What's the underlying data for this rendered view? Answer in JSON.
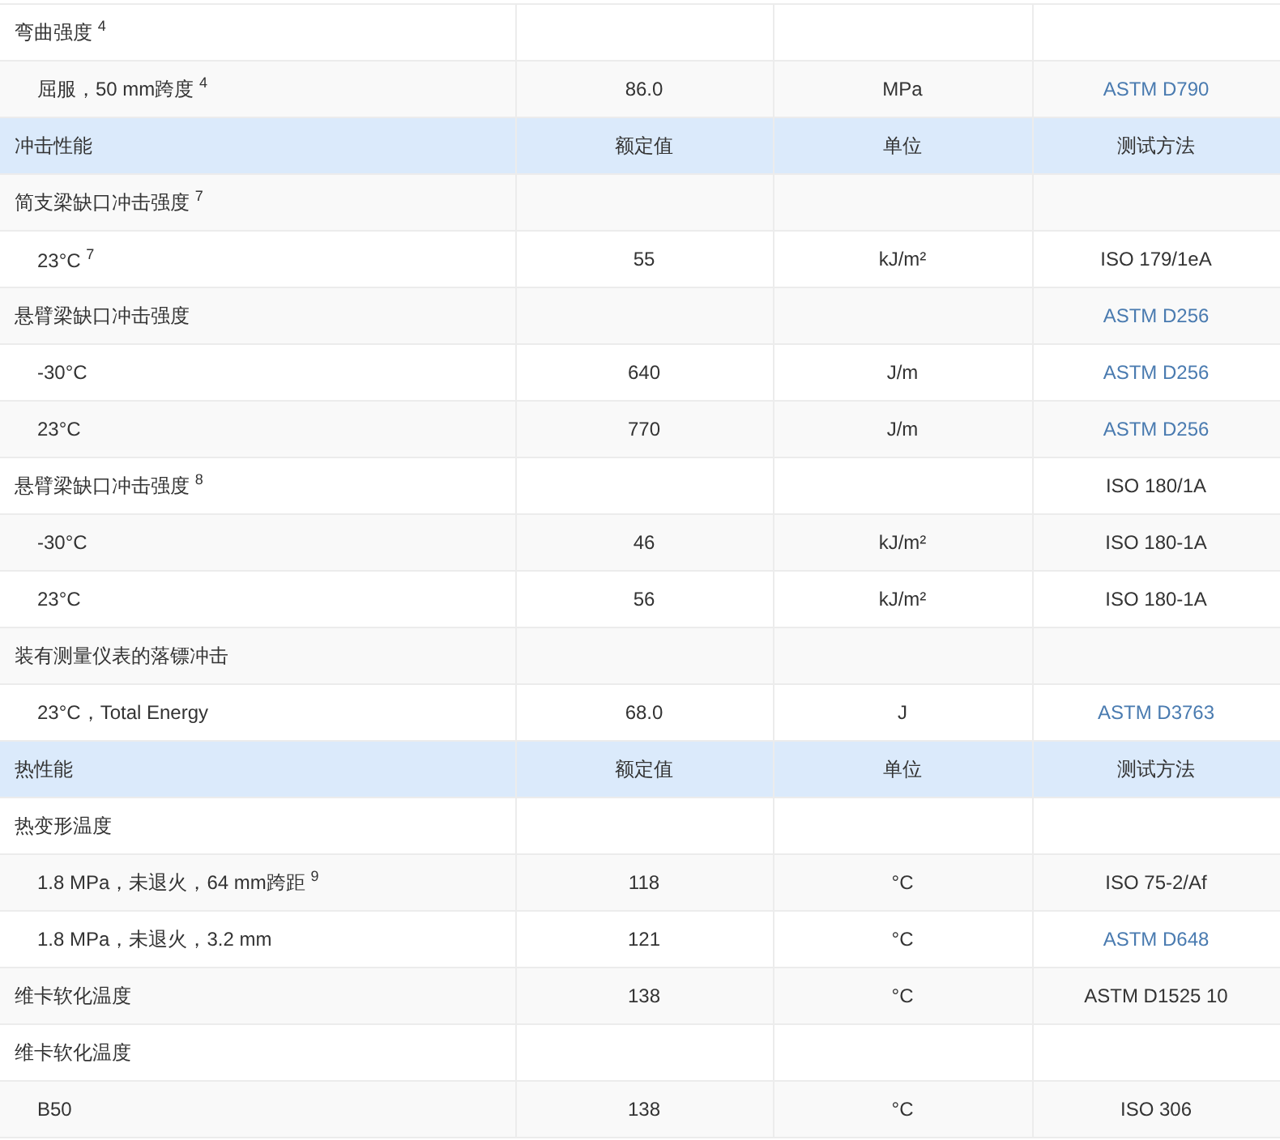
{
  "sections": [
    {
      "rows": [
        {
          "property": "弯曲强度 $^{4}$",
          "children": [
            {
              "property": "屈服，50 mm跨度 $^{4}$",
              "value": "86.0",
              "unit": "MPa",
              "method": "ASTM D790",
              "method_link": true
            }
          ]
        }
      ]
    },
    {
      "header": {
        "title": "冲击性能",
        "value": "额定值",
        "unit": "单位",
        "method": "测试方法"
      },
      "rows": [
        {
          "property": "简支梁缺口冲击强度 $^{7}$",
          "children": [
            {
              "property": "23°C $^{7}$",
              "value": "55",
              "unit": "kJ/m²",
              "method": "ISO 179/1eA",
              "method_link": false
            }
          ]
        },
        {
          "property": "悬臂梁缺口冲击强度",
          "method": "ASTM D256",
          "method_link": true,
          "children": [
            {
              "property": "-30°C",
              "value": "640",
              "unit": "J/m",
              "method": "ASTM D256",
              "method_link": true
            },
            {
              "property": "23°C",
              "value": "770",
              "unit": "J/m",
              "method": "ASTM D256",
              "method_link": true
            }
          ]
        },
        {
          "property": "悬臂梁缺口冲击强度 $^{8}$",
          "method": "ISO 180/1A",
          "method_link": false,
          "children": [
            {
              "property": "-30°C",
              "value": "46",
              "unit": "kJ/m²",
              "method": "ISO 180-1A",
              "method_link": false
            },
            {
              "property": "23°C",
              "value": "56",
              "unit": "kJ/m²",
              "method": "ISO 180-1A",
              "method_link": false
            }
          ]
        },
        {
          "property": "装有测量仪表的落镖冲击",
          "children": [
            {
              "property": "23°C，Total Energy",
              "value": "68.0",
              "unit": "J",
              "method": "ASTM D3763",
              "method_link": true
            }
          ]
        }
      ]
    },
    {
      "header": {
        "title": "热性能",
        "value": "额定值",
        "unit": "单位",
        "method": "测试方法"
      },
      "rows": [
        {
          "property": "热变形温度",
          "children": [
            {
              "property": "1.8 MPa，未退火，64 mm跨距 $^{9}$",
              "value": "118",
              "unit": "°C",
              "method": "ISO 75-2/Af",
              "method_link": false
            },
            {
              "property": "1.8 MPa，未退火，3.2 mm",
              "value": "121",
              "unit": "°C",
              "method": "ASTM D648",
              "method_link": true
            }
          ]
        },
        {
          "property": "维卡软化温度",
          "value": "138",
          "unit": "°C",
          "method": "ASTM D1525 10",
          "method_link": false
        },
        {
          "property": "维卡软化温度",
          "children": [
            {
              "property": "B50",
              "value": "138",
              "unit": "°C",
              "method": "ISO 306",
              "method_link": false
            }
          ]
        }
      ]
    }
  ]
}
